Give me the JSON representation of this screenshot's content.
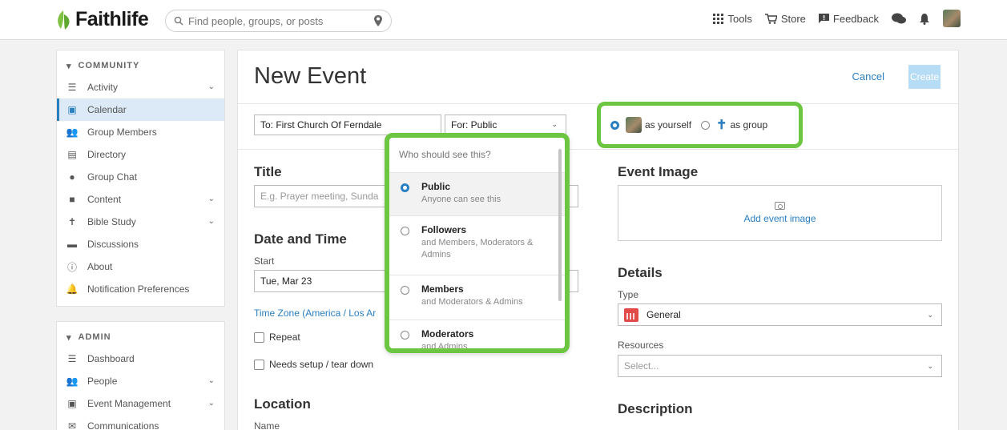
{
  "header": {
    "brand": "Faithlife",
    "search_placeholder": "Find people, groups, or posts",
    "nav": {
      "tools": "Tools",
      "store": "Store",
      "feedback": "Feedback"
    }
  },
  "sidebar": {
    "community_title": "COMMUNITY",
    "community_items": [
      {
        "label": "Activity",
        "icon": "list-icon"
      },
      {
        "label": "Calendar",
        "icon": "calendar-icon"
      },
      {
        "label": "Group Members",
        "icon": "people-icon"
      },
      {
        "label": "Directory",
        "icon": "directory-icon"
      },
      {
        "label": "Group Chat",
        "icon": "chat-icon"
      },
      {
        "label": "Content",
        "icon": "folder-icon"
      },
      {
        "label": "Bible Study",
        "icon": "bible-icon"
      },
      {
        "label": "Discussions",
        "icon": "discussions-icon"
      },
      {
        "label": "About",
        "icon": "info-icon"
      },
      {
        "label": "Notification Preferences",
        "icon": "bell-icon"
      }
    ],
    "admin_title": "ADMIN",
    "admin_items": [
      {
        "label": "Dashboard",
        "icon": "list-icon"
      },
      {
        "label": "People",
        "icon": "people-icon"
      },
      {
        "label": "Event Management",
        "icon": "calendar-icon"
      },
      {
        "label": "Communications",
        "icon": "envelope-icon"
      }
    ]
  },
  "form": {
    "title": "New Event",
    "cancel": "Cancel",
    "create": "Create",
    "to_value": "To: First Church Of Ferndale",
    "for_value": "For: Public",
    "as_yourself": "as yourself",
    "as_group": "as group",
    "title_label": "Title",
    "title_placeholder": "E.g. Prayer meeting, Sunda",
    "date_time_label": "Date and Time",
    "start_label": "Start",
    "start_value": "Tue, Mar 23",
    "timezone_link": "Time Zone (America / Los Ar",
    "repeat_label": "Repeat",
    "setup_label": "Needs setup / tear down",
    "location_label": "Location",
    "name_label": "Name",
    "event_image_label": "Event Image",
    "add_image": "Add event image",
    "details_label": "Details",
    "type_label": "Type",
    "type_value": "General",
    "resources_label": "Resources",
    "resources_placeholder": "Select...",
    "description_label": "Description"
  },
  "visibility_dropdown": {
    "heading": "Who should see this?",
    "options": [
      {
        "title": "Public",
        "sub": "Anyone can see this"
      },
      {
        "title": "Followers",
        "sub": "and Members, Moderators & Admins"
      },
      {
        "title": "Members",
        "sub": "and Moderators & Admins"
      },
      {
        "title": "Moderators",
        "sub": "and Admins"
      }
    ]
  },
  "colors": {
    "accent": "#2a7fc1",
    "highlight": "#6cc641",
    "brand_green": "#7fc142"
  }
}
